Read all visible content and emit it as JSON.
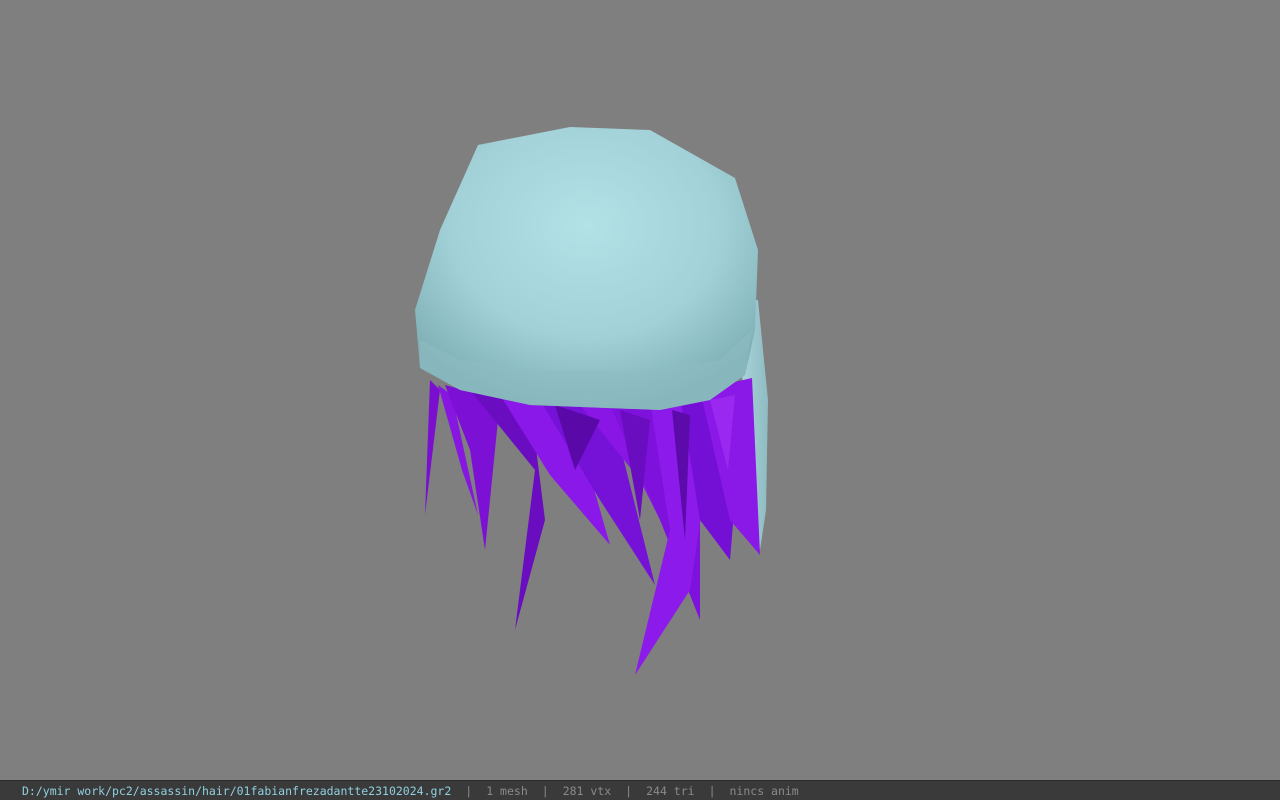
{
  "viewport": {
    "background": "#7f7f7f",
    "model": {
      "cap_color": "#a6d6dc",
      "strand_color": "#8a14e6"
    }
  },
  "statusbar": {
    "file_path": "D:/ymir work/pc2/assassin/hair/01fabianfrezadantte23102024.gr2",
    "separator": "|",
    "mesh_count": "1 mesh",
    "vertex_count": "281 vtx",
    "triangle_count": "244 tri",
    "anim_status": "nincs anim",
    "path_color": "#8fd0e0",
    "stat_color": "#8a8a8a"
  }
}
